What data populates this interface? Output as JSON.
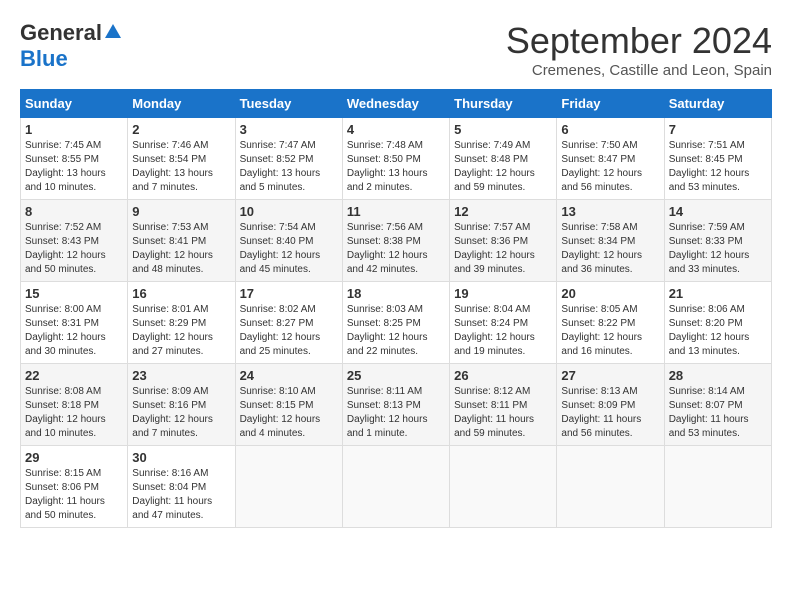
{
  "header": {
    "logo_general": "General",
    "logo_blue": "Blue",
    "month": "September 2024",
    "location": "Cremenes, Castille and Leon, Spain"
  },
  "weekdays": [
    "Sunday",
    "Monday",
    "Tuesday",
    "Wednesday",
    "Thursday",
    "Friday",
    "Saturday"
  ],
  "weeks": [
    [
      {
        "day": 1,
        "info": "Sunrise: 7:45 AM\nSunset: 8:55 PM\nDaylight: 13 hours\nand 10 minutes."
      },
      {
        "day": 2,
        "info": "Sunrise: 7:46 AM\nSunset: 8:54 PM\nDaylight: 13 hours\nand 7 minutes."
      },
      {
        "day": 3,
        "info": "Sunrise: 7:47 AM\nSunset: 8:52 PM\nDaylight: 13 hours\nand 5 minutes."
      },
      {
        "day": 4,
        "info": "Sunrise: 7:48 AM\nSunset: 8:50 PM\nDaylight: 13 hours\nand 2 minutes."
      },
      {
        "day": 5,
        "info": "Sunrise: 7:49 AM\nSunset: 8:48 PM\nDaylight: 12 hours\nand 59 minutes."
      },
      {
        "day": 6,
        "info": "Sunrise: 7:50 AM\nSunset: 8:47 PM\nDaylight: 12 hours\nand 56 minutes."
      },
      {
        "day": 7,
        "info": "Sunrise: 7:51 AM\nSunset: 8:45 PM\nDaylight: 12 hours\nand 53 minutes."
      }
    ],
    [
      {
        "day": 8,
        "info": "Sunrise: 7:52 AM\nSunset: 8:43 PM\nDaylight: 12 hours\nand 50 minutes."
      },
      {
        "day": 9,
        "info": "Sunrise: 7:53 AM\nSunset: 8:41 PM\nDaylight: 12 hours\nand 48 minutes."
      },
      {
        "day": 10,
        "info": "Sunrise: 7:54 AM\nSunset: 8:40 PM\nDaylight: 12 hours\nand 45 minutes."
      },
      {
        "day": 11,
        "info": "Sunrise: 7:56 AM\nSunset: 8:38 PM\nDaylight: 12 hours\nand 42 minutes."
      },
      {
        "day": 12,
        "info": "Sunrise: 7:57 AM\nSunset: 8:36 PM\nDaylight: 12 hours\nand 39 minutes."
      },
      {
        "day": 13,
        "info": "Sunrise: 7:58 AM\nSunset: 8:34 PM\nDaylight: 12 hours\nand 36 minutes."
      },
      {
        "day": 14,
        "info": "Sunrise: 7:59 AM\nSunset: 8:33 PM\nDaylight: 12 hours\nand 33 minutes."
      }
    ],
    [
      {
        "day": 15,
        "info": "Sunrise: 8:00 AM\nSunset: 8:31 PM\nDaylight: 12 hours\nand 30 minutes."
      },
      {
        "day": 16,
        "info": "Sunrise: 8:01 AM\nSunset: 8:29 PM\nDaylight: 12 hours\nand 27 minutes."
      },
      {
        "day": 17,
        "info": "Sunrise: 8:02 AM\nSunset: 8:27 PM\nDaylight: 12 hours\nand 25 minutes."
      },
      {
        "day": 18,
        "info": "Sunrise: 8:03 AM\nSunset: 8:25 PM\nDaylight: 12 hours\nand 22 minutes."
      },
      {
        "day": 19,
        "info": "Sunrise: 8:04 AM\nSunset: 8:24 PM\nDaylight: 12 hours\nand 19 minutes."
      },
      {
        "day": 20,
        "info": "Sunrise: 8:05 AM\nSunset: 8:22 PM\nDaylight: 12 hours\nand 16 minutes."
      },
      {
        "day": 21,
        "info": "Sunrise: 8:06 AM\nSunset: 8:20 PM\nDaylight: 12 hours\nand 13 minutes."
      }
    ],
    [
      {
        "day": 22,
        "info": "Sunrise: 8:08 AM\nSunset: 8:18 PM\nDaylight: 12 hours\nand 10 minutes."
      },
      {
        "day": 23,
        "info": "Sunrise: 8:09 AM\nSunset: 8:16 PM\nDaylight: 12 hours\nand 7 minutes."
      },
      {
        "day": 24,
        "info": "Sunrise: 8:10 AM\nSunset: 8:15 PM\nDaylight: 12 hours\nand 4 minutes."
      },
      {
        "day": 25,
        "info": "Sunrise: 8:11 AM\nSunset: 8:13 PM\nDaylight: 12 hours\nand 1 minute."
      },
      {
        "day": 26,
        "info": "Sunrise: 8:12 AM\nSunset: 8:11 PM\nDaylight: 11 hours\nand 59 minutes."
      },
      {
        "day": 27,
        "info": "Sunrise: 8:13 AM\nSunset: 8:09 PM\nDaylight: 11 hours\nand 56 minutes."
      },
      {
        "day": 28,
        "info": "Sunrise: 8:14 AM\nSunset: 8:07 PM\nDaylight: 11 hours\nand 53 minutes."
      }
    ],
    [
      {
        "day": 29,
        "info": "Sunrise: 8:15 AM\nSunset: 8:06 PM\nDaylight: 11 hours\nand 50 minutes."
      },
      {
        "day": 30,
        "info": "Sunrise: 8:16 AM\nSunset: 8:04 PM\nDaylight: 11 hours\nand 47 minutes."
      },
      null,
      null,
      null,
      null,
      null
    ]
  ]
}
